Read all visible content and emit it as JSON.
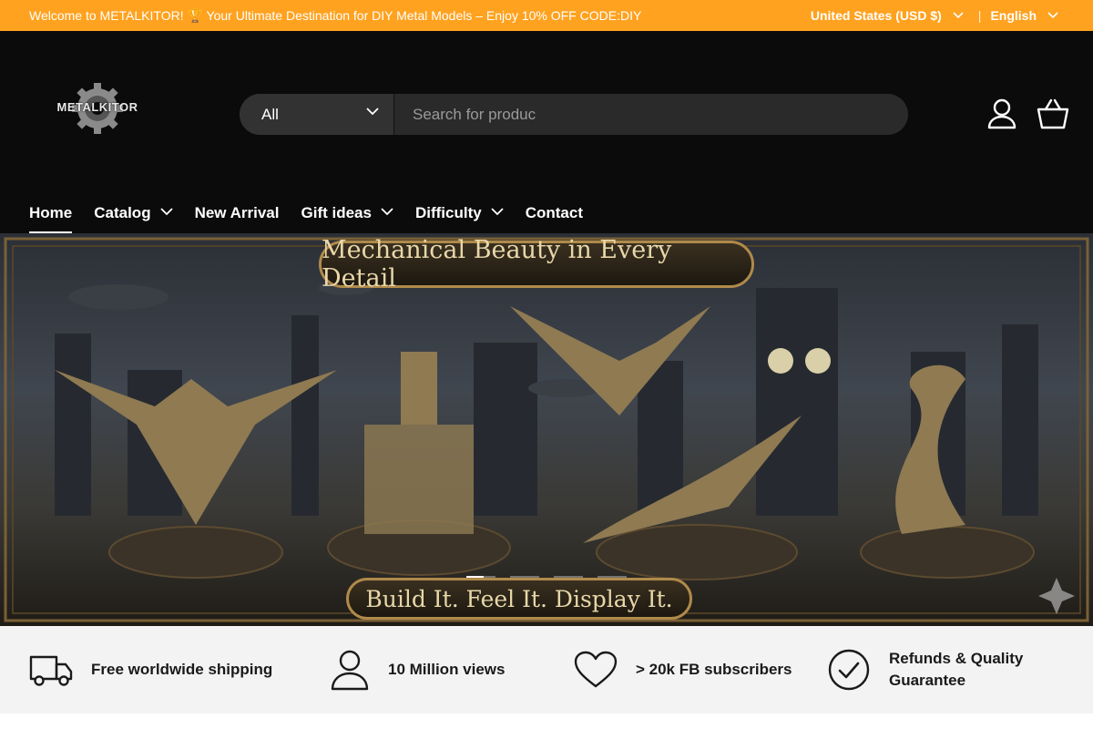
{
  "announcement": {
    "message": "Welcome to METALKITOR! 🏆 Your Ultimate Destination for DIY Metal Models – Enjoy 10% OFF CODE:DIY",
    "country": "United States (USD $)",
    "separator": "|",
    "language": "English"
  },
  "brand": {
    "logo_text": "METALKITOR"
  },
  "search": {
    "category": "All",
    "placeholder": "Search for produc"
  },
  "nav": {
    "items": [
      {
        "label": "Home"
      },
      {
        "label": "Catalog"
      },
      {
        "label": "New Arrival"
      },
      {
        "label": "Gift ideas"
      },
      {
        "label": "Difficulty"
      },
      {
        "label": "Contact"
      }
    ]
  },
  "hero": {
    "title": "Mechanical Beauty in Every Detail",
    "subtitle": "Build It. Feel It. Display It.",
    "slide_count": 4,
    "active_slide": 1
  },
  "features": [
    {
      "icon": "truck-icon",
      "text": "Free worldwide shipping"
    },
    {
      "icon": "person-icon",
      "text": "10 Million views"
    },
    {
      "icon": "heart-icon",
      "text": "> 20k FB subscribers"
    },
    {
      "icon": "check-circle-icon",
      "text": "Refunds & Quality Guarantee"
    }
  ],
  "colors": {
    "announcement_bg": "#ffa21f",
    "header_bg": "#0b0b0b"
  }
}
